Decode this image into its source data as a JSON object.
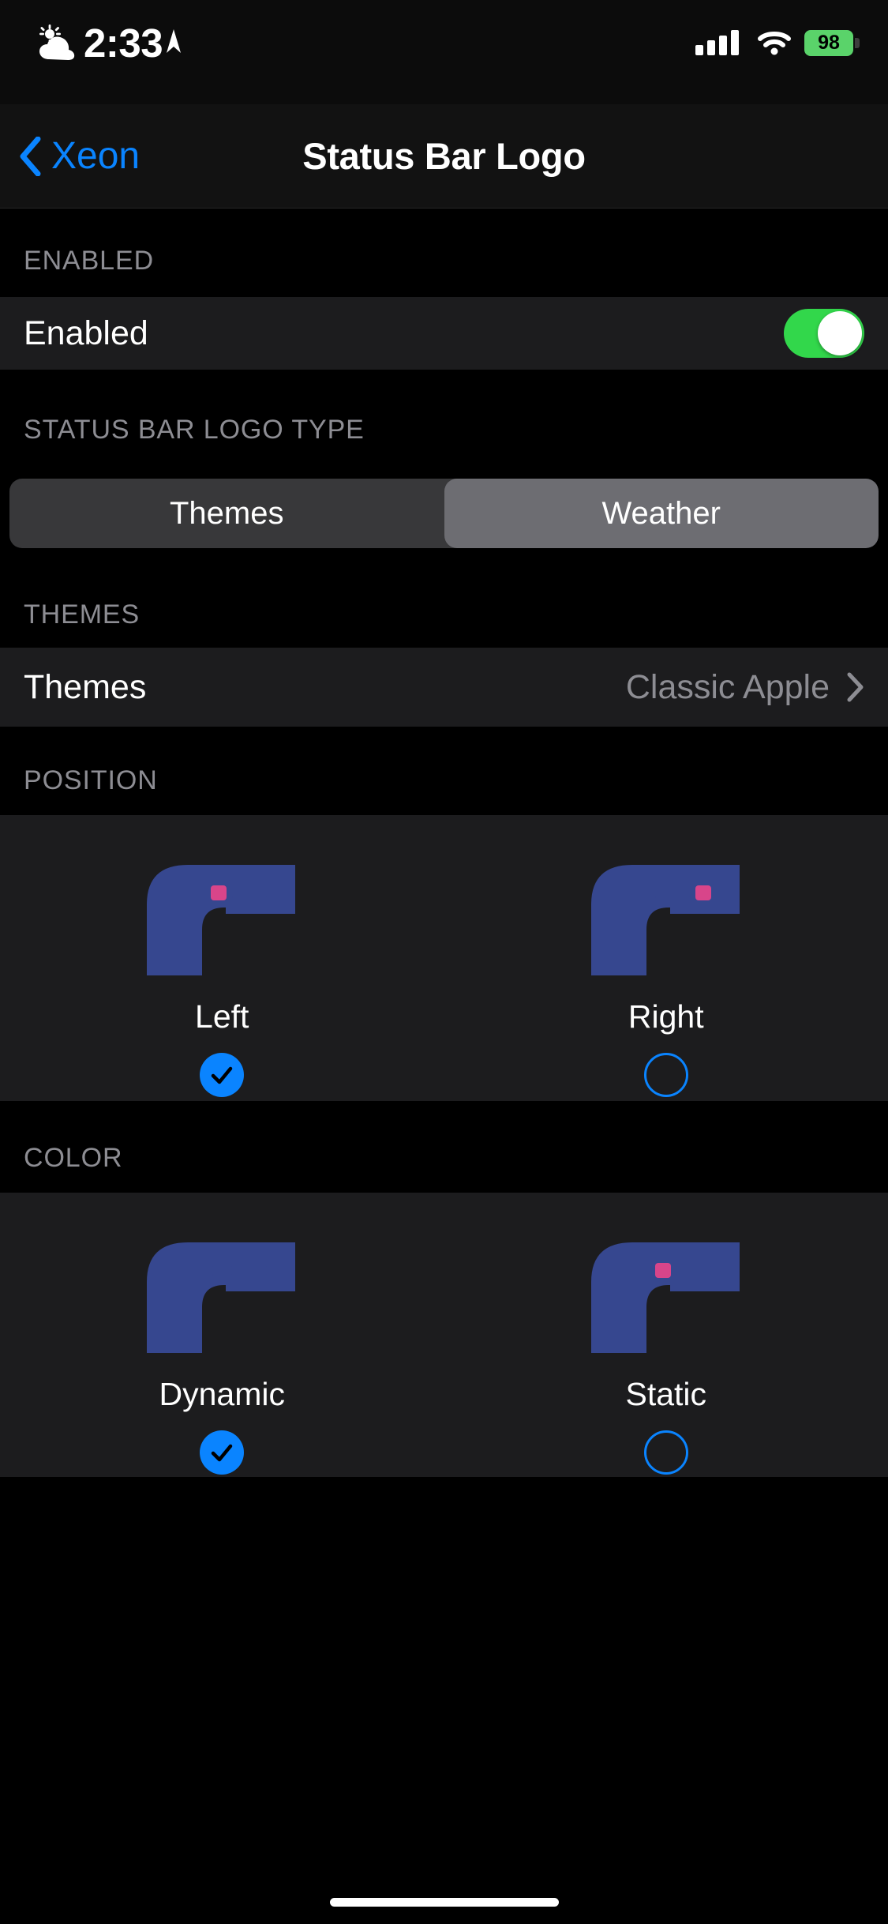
{
  "status_bar": {
    "weather_icon": "sun-behind-cloud-icon",
    "time": "2:33",
    "location_icon": "location-arrow-icon",
    "signal_icon": "cellular-signal-icon",
    "wifi_icon": "wifi-icon",
    "battery_percent": "98",
    "battery_color": "#5ad36a"
  },
  "nav": {
    "back_label": "Xeon",
    "back_icon": "chevron-left-icon",
    "title": "Status Bar Logo",
    "accent_color": "#0a84ff"
  },
  "sections": {
    "enabled": {
      "header": "ENABLED",
      "row_label": "Enabled",
      "toggle_on": true,
      "toggle_color": "#32d74b"
    },
    "logo_type": {
      "header": "STATUS BAR LOGO TYPE",
      "segments": [
        {
          "label": "Themes",
          "selected": false
        },
        {
          "label": "Weather",
          "selected": true
        }
      ]
    },
    "themes": {
      "header": "THEMES",
      "row_label": "Themes",
      "row_value": "Classic Apple",
      "chevron_icon": "chevron-right-icon"
    },
    "position": {
      "header": "POSITION",
      "options": [
        {
          "label": "Left",
          "selected": true
        },
        {
          "label": "Right",
          "selected": false
        }
      ]
    },
    "color": {
      "header": "COLOR",
      "options": [
        {
          "label": "Dynamic",
          "selected": true
        },
        {
          "label": "Static",
          "selected": false
        }
      ]
    }
  },
  "logo_colors": {
    "blue": "#36478f",
    "pink": "#d8458a"
  }
}
